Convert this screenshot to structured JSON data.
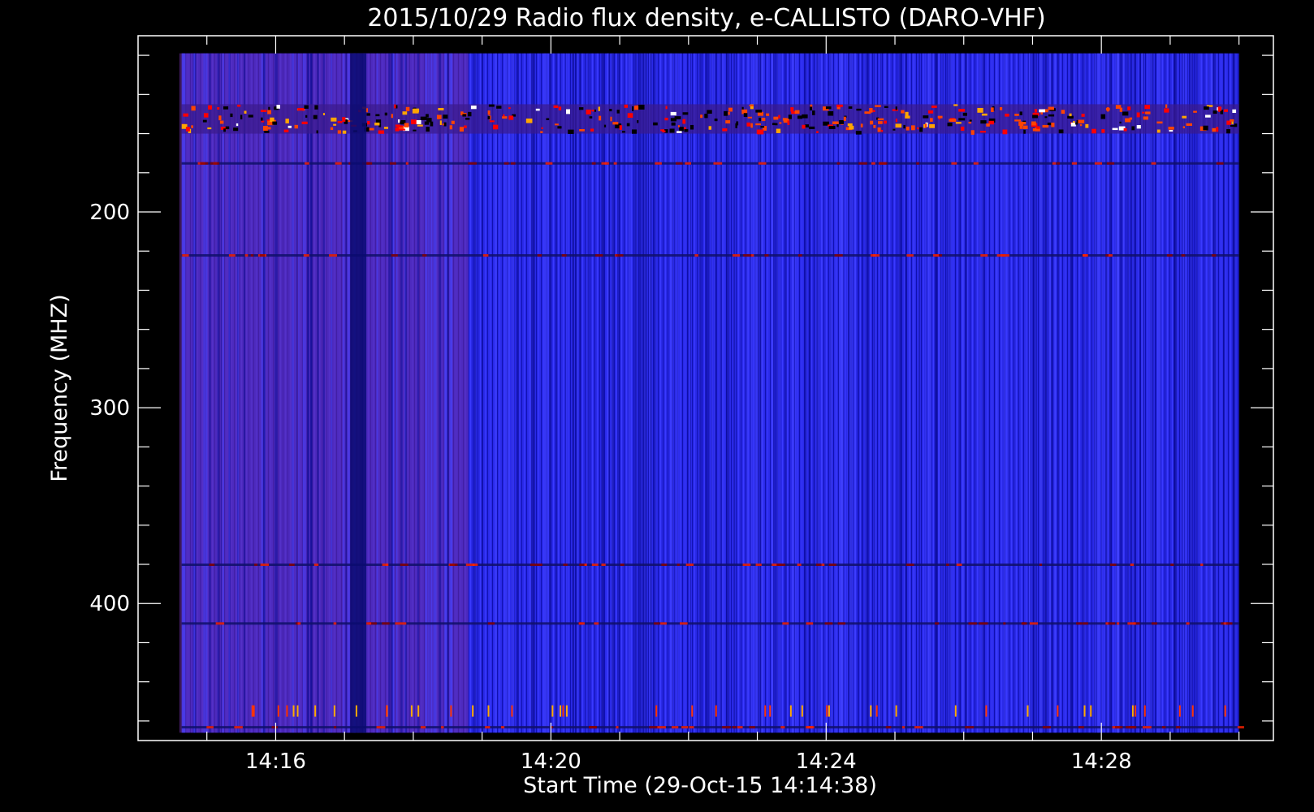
{
  "chart_data": {
    "type": "heatmap",
    "title": "2015/10/29  Radio flux density, e-CALLISTO (DARO-VHF)",
    "xlabel": "Start Time (29-Oct-15 14:14:38)",
    "ylabel": "Frequency (MHZ)",
    "x_ticks": [
      "14:16",
      "14:20",
      "14:24",
      "14:28"
    ],
    "x_tick_minutes": [
      16,
      20,
      24,
      28
    ],
    "xlim_minutes": [
      14.0,
      30.5
    ],
    "data_x_range_minutes": [
      14.6333,
      30.0
    ],
    "y_ticks": [
      200,
      300,
      400
    ],
    "ylim": [
      470,
      110
    ],
    "data_y_range": [
      466,
      119
    ],
    "colormap": [
      "#000000",
      "#0000ff",
      "#8b0000",
      "#ff0000",
      "#ffa500",
      "#ffffff"
    ],
    "background_color": "#2020e8",
    "features": [
      {
        "kind": "broadband_interference",
        "freq_range": [
          145,
          160
        ],
        "note_color": "#ff4500"
      },
      {
        "kind": "narrowband_line",
        "freq": 175
      },
      {
        "kind": "narrowband_line",
        "freq": 222
      },
      {
        "kind": "narrowband_line",
        "freq": 380
      },
      {
        "kind": "narrowband_line",
        "freq": 410
      },
      {
        "kind": "narrowband_line",
        "freq": 463
      },
      {
        "kind": "dark_column",
        "time_minutes": 17.2
      },
      {
        "kind": "elevated_region",
        "time_range": [
          14.6,
          18.8
        ],
        "note_color": "#6a2a9a"
      }
    ]
  }
}
